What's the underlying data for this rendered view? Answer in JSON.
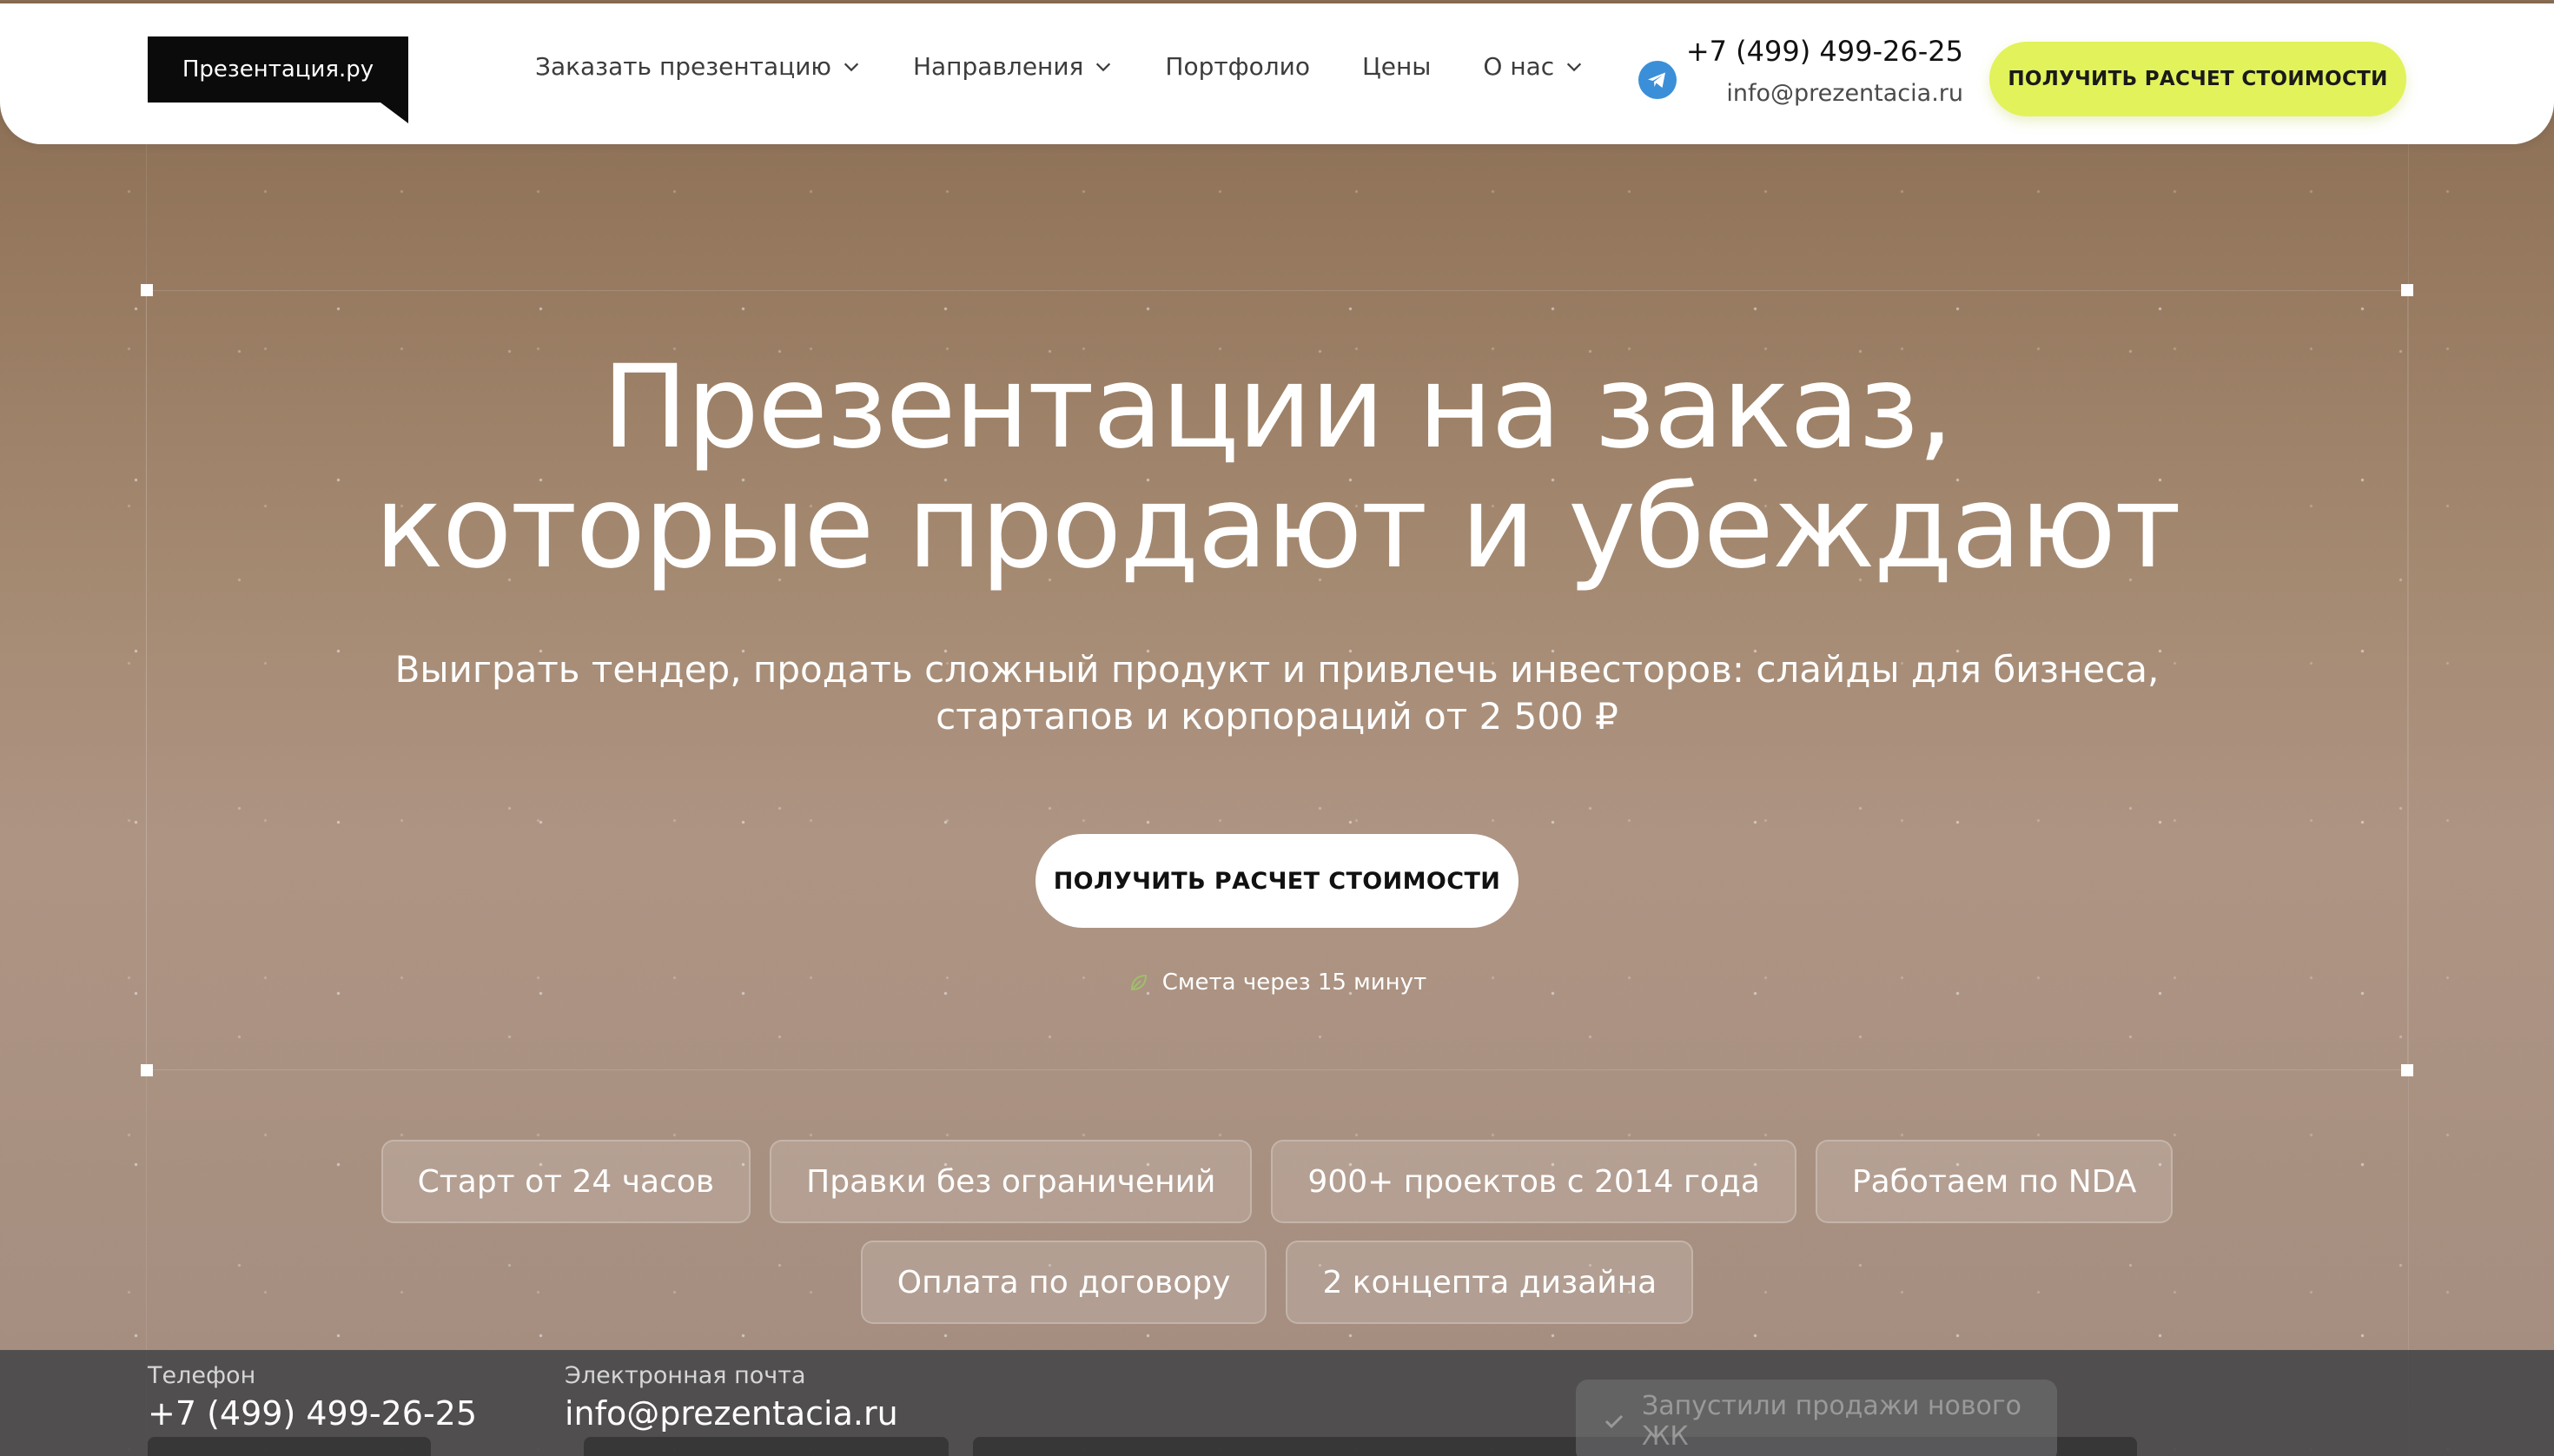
{
  "header": {
    "logo_text": "Презентация.ру",
    "nav": [
      {
        "label": "Заказать презентацию",
        "has_dropdown": true
      },
      {
        "label": "Направления",
        "has_dropdown": true
      },
      {
        "label": "Портфолио",
        "has_dropdown": false
      },
      {
        "label": "Цены",
        "has_dropdown": false
      },
      {
        "label": "О нас",
        "has_dropdown": true
      }
    ],
    "phone": "+7 (499) 499-26-25",
    "email": "info@prezentacia.ru",
    "cta_label": "ПОЛУЧИТЬ РАСЧЕТ СТОИМОСТИ",
    "icons": {
      "telegram": "telegram-icon",
      "dropdown": "chevron-down-icon"
    }
  },
  "hero": {
    "title_line1": "Презентации на заказ,",
    "title_line2": "которые продают и убеждают",
    "subtitle_line1": "Выиграть тендер, продать сложный продукт и привлечь инвесторов: слайды для бизнеса,",
    "subtitle_line2": "стартапов и корпораций от 2 500 ₽",
    "cta_label": "ПОЛУЧИТЬ РАСЧЕТ СТОИМОСТИ",
    "estimate_note": "Смета через 15 минут"
  },
  "tags": {
    "row1": [
      "Старт от 24 часов",
      "Правки без ограничений",
      "900+ проектов с 2014 года",
      "Работаем по NDA"
    ],
    "row2": [
      "Оплата по договору",
      "2 концепта дизайна"
    ]
  },
  "bottom_bar": {
    "phone_label": "Телефон",
    "phone_value": "+7 (499) 499-26-25",
    "email_label": "Электронная почта",
    "email_value": "info@prezentacia.ru",
    "toast_text": "Запустили продажи нового ЖК"
  },
  "colors": {
    "accent": "#e2f25a",
    "logo_bg": "#0b0b0b",
    "telegram": "#3b8fd8",
    "hero_bg_top": "#876b51",
    "hero_bg_bottom": "#a38c80"
  }
}
